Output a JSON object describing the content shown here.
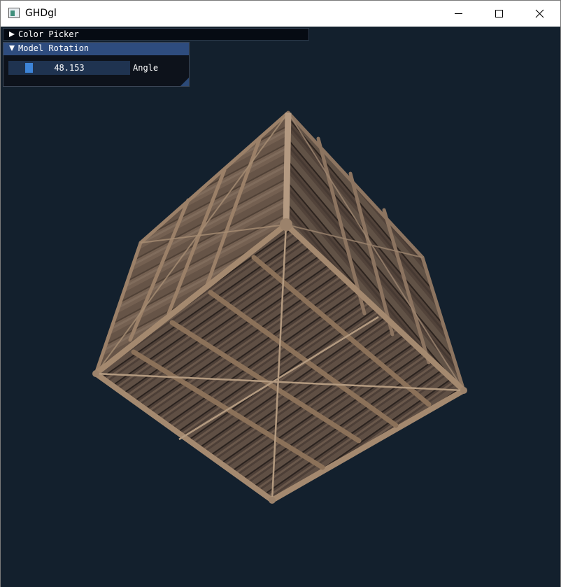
{
  "window": {
    "title": "GHDgl",
    "controls": [
      "minimize-icon",
      "maximize-icon",
      "close-icon"
    ]
  },
  "imgui": {
    "color_picker": {
      "label": "Color Picker",
      "expanded": false
    },
    "model_rotation": {
      "label": "Model Rotation",
      "expanded": true,
      "slider": {
        "value_text": "48.153",
        "label": "Angle"
      }
    }
  },
  "scene": {
    "background_color": "#13202d",
    "object": "wooden-crate-cube"
  }
}
